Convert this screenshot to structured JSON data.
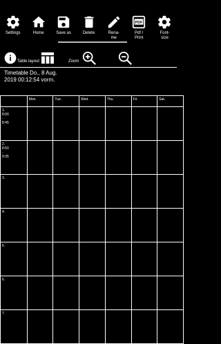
{
  "toolbar": {
    "items": [
      {
        "label": "Settings",
        "icon": "gear-icon"
      },
      {
        "label": "Home",
        "icon": "home-icon"
      },
      {
        "label": "Save as",
        "icon": "save-icon"
      },
      {
        "label": "Delete",
        "icon": "trash-icon"
      },
      {
        "label": "Rena-me",
        "icon": "pencil-icon"
      },
      {
        "label": "Pdf / Print",
        "icon": "pdf-icon"
      },
      {
        "label": "Font-size",
        "icon": "gear-icon"
      }
    ]
  },
  "secondary": {
    "table_layout_label": "Table layout",
    "zoom_label": "Zoom"
  },
  "timetable": {
    "title_line1": "Timetable Do., 8 Aug.",
    "title_line2": "2019 00:12:54 vorm.",
    "days": [
      "Mon.",
      "Tue.",
      "Wed.",
      "Thu.",
      "Fri.",
      "Sat."
    ],
    "periods": [
      {
        "label": "1.",
        "start": "8:00",
        "sep": "-",
        "end": "8:45"
      },
      {
        "label": "2.",
        "start": "8:50",
        "sep": "-",
        "end": "9:35"
      },
      {
        "label": "3.",
        "start": "",
        "sep": "",
        "end": ""
      },
      {
        "label": "4.",
        "start": "",
        "sep": "",
        "end": ""
      },
      {
        "label": "5.",
        "start": "",
        "sep": "",
        "end": ""
      },
      {
        "label": "6.",
        "start": "",
        "sep": "",
        "end": ""
      },
      {
        "label": "7.",
        "start": "",
        "sep": "",
        "end": ""
      }
    ]
  }
}
